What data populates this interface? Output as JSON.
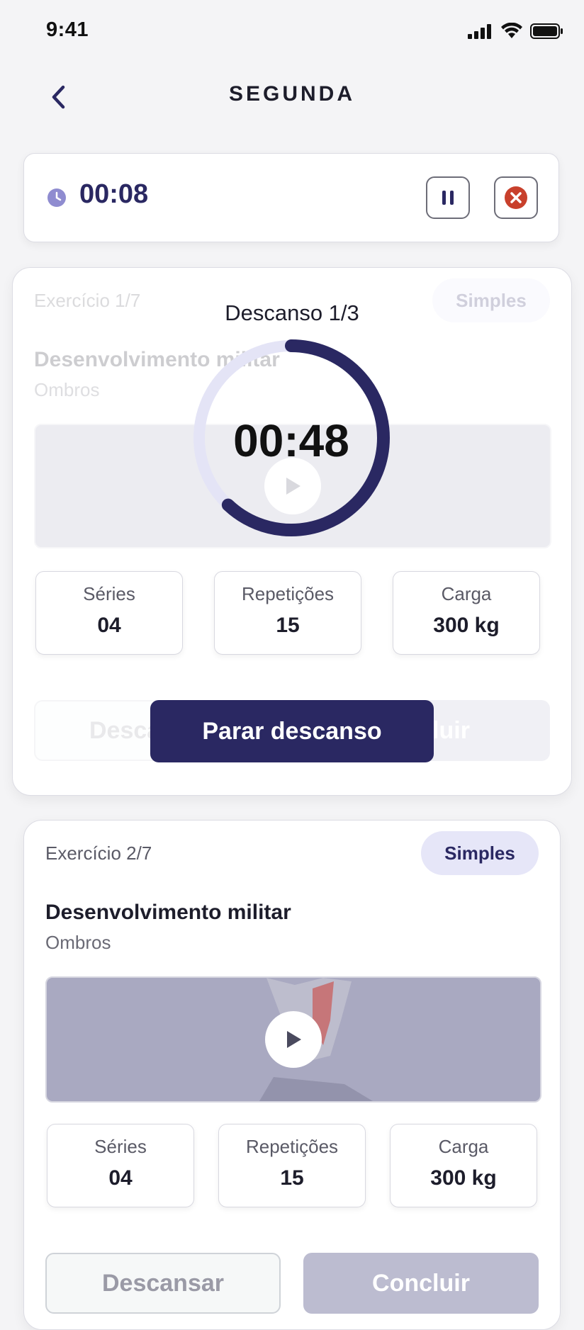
{
  "status_bar": {
    "time": "9:41"
  },
  "header": {
    "title": "SEGUNDA"
  },
  "timer": {
    "elapsed": "00:08"
  },
  "rest_overlay": {
    "label": "Descanso 1/3",
    "countdown": "00:48",
    "progress": 0.62,
    "stop_label": "Parar descanso"
  },
  "exercises": [
    {
      "counter": "Exercício 1/7",
      "type": "Simples",
      "name": "Desenvolvimento militar",
      "group": "Ombros",
      "stats": [
        {
          "label": "Séries",
          "value": "04"
        },
        {
          "label": "Repetições",
          "value": "15"
        },
        {
          "label": "Carga",
          "value": "300 kg"
        }
      ],
      "rest_label": "Descansar",
      "done_label": "Concluir"
    },
    {
      "counter": "Exercício 2/7",
      "type": "Simples",
      "name": "Desenvolvimento militar",
      "group": "Ombros",
      "stats": [
        {
          "label": "Séries",
          "value": "04"
        },
        {
          "label": "Repetições",
          "value": "15"
        },
        {
          "label": "Carga",
          "value": "300 kg"
        }
      ],
      "rest_label": "Descansar",
      "done_label": "Concluir"
    }
  ],
  "colors": {
    "primary": "#2a2862",
    "ring_track": "#e4e4f6",
    "close": "#c8402c"
  }
}
